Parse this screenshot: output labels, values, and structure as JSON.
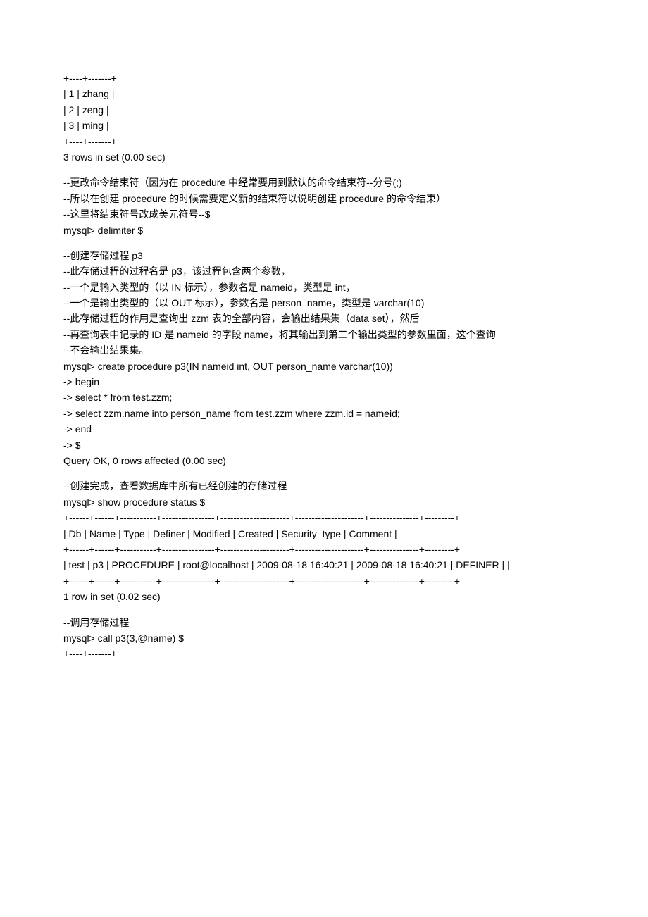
{
  "lines": [
    "+----+-------+",
    "| 1 | zhang |",
    "| 2 | zeng |",
    "| 3 | ming |",
    "+----+-------+",
    "3 rows in set (0.00 sec)",
    "",
    "--更改命令结束符（因为在 procedure 中经常要用到默认的命令结束符--分号(;)",
    "--所以在创建 procedure 的时候需要定义新的结束符以说明创建 procedure 的命令结束）",
    "--这里将结束符号改成美元符号--$",
    "mysql> delimiter $",
    "",
    "--创建存储过程 p3",
    "--此存储过程的过程名是 p3，该过程包含两个参数，",
    "--一个是输入类型的（以 IN 标示），参数名是 nameid，类型是 int，",
    "--一个是输出类型的（以 OUT 标示），参数名是 person_name，类型是 varchar(10)",
    "--此存储过程的作用是查询出 zzm 表的全部内容，会输出结果集（data set），然后",
    "--再查询表中记录的 ID 是 nameid 的字段 name，将其输出到第二个输出类型的参数里面，这个查询",
    "--不会输出结果集。",
    "mysql> create procedure p3(IN nameid int, OUT person_name varchar(10))",
    "-> begin",
    "-> select * from test.zzm;",
    "-> select zzm.name into person_name from test.zzm where zzm.id = nameid;",
    "-> end",
    "-> $",
    "Query OK, 0 rows affected (0.00 sec)",
    "",
    "--创建完成，查看数据库中所有已经创建的存储过程",
    "mysql> show procedure status $",
    "+------+------+-----------+----------------+---------------------+---------------------+---------------+---------+",
    "| Db | Name | Type | Definer | Modified | Created | Security_type | Comment |",
    "+------+------+-----------+----------------+---------------------+---------------------+---------------+---------+",
    "| test | p3 | PROCEDURE | root@localhost | 2009-08-18 16:40:21 | 2009-08-18 16:40:21 | DEFINER | |",
    "+------+------+-----------+----------------+---------------------+---------------------+---------------+---------+",
    "1 row in set (0.02 sec)",
    "",
    "--调用存储过程",
    "mysql> call p3(3,@name) $",
    "+----+-------+"
  ]
}
